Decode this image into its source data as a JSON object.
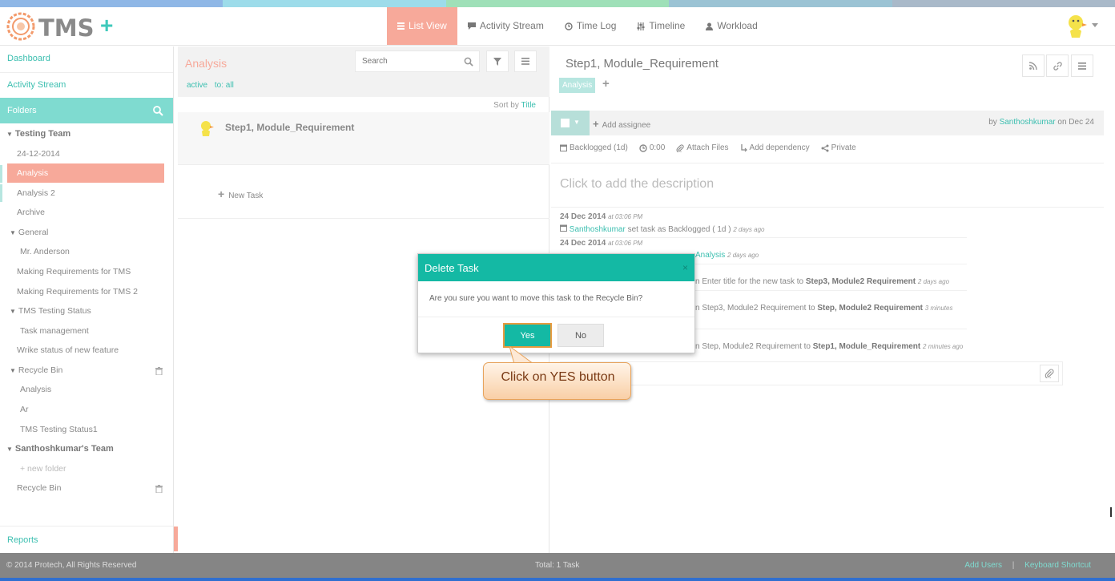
{
  "app": {
    "logo_text": "TMS",
    "add_label": "+"
  },
  "colors": {
    "teal": "#14b9a4",
    "teal_light": "#7fdbd0",
    "salmon": "#f7a99a",
    "link": "#3cbfb0"
  },
  "nav": {
    "tabs": [
      {
        "label": "List View",
        "icon": "list-icon",
        "active": true
      },
      {
        "label": "Activity Stream",
        "icon": "comment-icon",
        "active": false
      },
      {
        "label": "Time Log",
        "icon": "clock-icon",
        "active": false
      },
      {
        "label": "Timeline",
        "icon": "sliders-icon",
        "active": false
      },
      {
        "label": "Workload",
        "icon": "user-icon",
        "active": false
      }
    ]
  },
  "sidebar": {
    "dashboard": "Dashboard",
    "activity_stream": "Activity Stream",
    "folders": "Folders",
    "tree": [
      {
        "label": "Testing Team",
        "level": 0,
        "caret": true,
        "bold": true
      },
      {
        "label": "24-12-2014",
        "level": 1
      },
      {
        "label": "Analysis",
        "level": 1,
        "selected": true
      },
      {
        "label": "Analysis 2",
        "level": 1
      },
      {
        "label": "Archive",
        "level": 1
      },
      {
        "label": "General",
        "level": 1,
        "caret": true
      },
      {
        "label": "Mr. Anderson",
        "level": 2
      },
      {
        "label": "Making Requirements for TMS",
        "level": 1
      },
      {
        "label": "Making Requirements for TMS 2",
        "level": 1
      },
      {
        "label": "TMS Testing Status",
        "level": 1,
        "caret": true
      },
      {
        "label": "Task management",
        "level": 2
      },
      {
        "label": "Wrike status of new feature",
        "level": 1
      },
      {
        "label": "Recycle Bin",
        "level": 1,
        "caret": true,
        "trash": true
      },
      {
        "label": "Analysis",
        "level": 2
      },
      {
        "label": "Ar",
        "level": 2
      },
      {
        "label": "TMS Testing Status1",
        "level": 2
      },
      {
        "label": "Santhoshkumar's Team",
        "level": 0,
        "caret": true,
        "bold": true
      },
      {
        "label": "+ new folder",
        "level": 2,
        "muted": true
      },
      {
        "label": "Recycle Bin",
        "level": 1,
        "trash": true
      }
    ],
    "reports": "Reports"
  },
  "list": {
    "title": "Analysis",
    "search_placeholder": "Search",
    "filters": [
      "active",
      "to: all"
    ],
    "sort_prefix": "Sort by",
    "sort_field": "Title",
    "tasks": [
      {
        "title": "Step1, Module_Requirement"
      }
    ],
    "new_task": "New Task"
  },
  "detail": {
    "title": "Step1, Module_Requirement",
    "tag": "Analysis",
    "add_assignee": "Add assignee",
    "by_prefix": "by",
    "by_user": "Santhoshkumar",
    "by_date": "on Dec 24",
    "meta": [
      {
        "label": "Backlogged (1d)",
        "icon": "calendar-icon"
      },
      {
        "label": "0:00",
        "icon": "clock-icon"
      },
      {
        "label": "Attach Files",
        "icon": "paperclip-icon"
      },
      {
        "label": "Add dependency",
        "icon": "dependency-icon"
      },
      {
        "label": "Private",
        "icon": "share-icon"
      }
    ],
    "description_placeholder": "Click to add the description",
    "log": {
      "d1_date": "24 Dec 2014",
      "d1_time": "at 03:06 PM",
      "d1_user": "Santhoshkumar",
      "d1_text": "set task as Backlogged ( 1d )",
      "d1_ago": "2 days ago",
      "d2_date": "24 Dec 2014",
      "d2_time": "at 03:06 PM",
      "d2_link": "Analysis",
      "d2_ago": "2 days ago",
      "l3_pre": "n Enter title for the new task to",
      "l3_bold": "Step3, Module2 Requirement",
      "l3_ago": "2 days ago",
      "l4_pre": "n Step3, Module2 Requirement to",
      "l4_bold": "Step, Module2 Requirement",
      "l4_ago": "3 minutes",
      "l5_pre": "n Step, Module2 Requirement to",
      "l5_bold": "Step1, Module_Requirement",
      "l5_ago": "2 minutes ago"
    }
  },
  "modal": {
    "title": "Delete Task",
    "close": "×",
    "message": "Are you sure you want to move this task to the Recycle Bin?",
    "yes": "Yes",
    "no": "No"
  },
  "callout": {
    "text": "Click on YES button"
  },
  "footer": {
    "copyright": "© 2014 Protech, All Rights Reserved",
    "total": "Total: 1 Task",
    "add_users": "Add Users",
    "separator": "|",
    "keyboard": "Keyboard Shortcut"
  }
}
